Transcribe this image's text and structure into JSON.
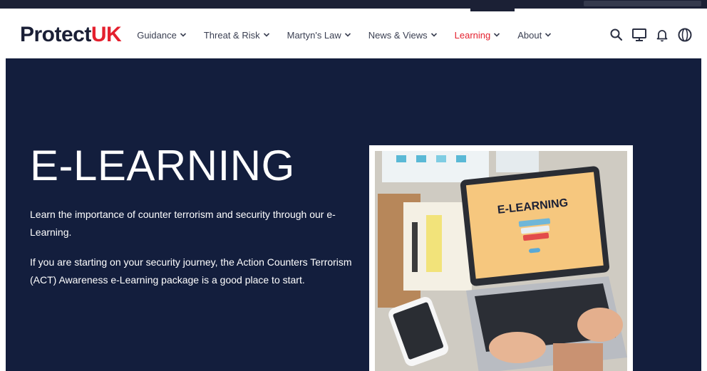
{
  "brand": {
    "name_main": "Protect",
    "name_accent": "UK",
    "accent_color": "#e4202e",
    "dark_color": "#131e3d"
  },
  "nav": {
    "items": [
      {
        "label": "Guidance",
        "active": false
      },
      {
        "label": "Threat & Risk",
        "active": false
      },
      {
        "label": "Martyn's Law",
        "active": false
      },
      {
        "label": "News & Views",
        "active": false
      },
      {
        "label": "Learning",
        "active": true
      },
      {
        "label": "About",
        "active": false
      }
    ],
    "tools": [
      "search-icon",
      "monitor-icon",
      "bell-icon",
      "globe-icon"
    ]
  },
  "hero": {
    "title": "E-LEARNING",
    "paragraph1": "Learn the importance of counter terrorism and security through our e-Learning.",
    "paragraph2": "If you are starting on your security journey, the Action Counters Terrorism (ACT) Awareness e-Learning package is a good place to start.",
    "image_caption": "E-LEARNING"
  }
}
